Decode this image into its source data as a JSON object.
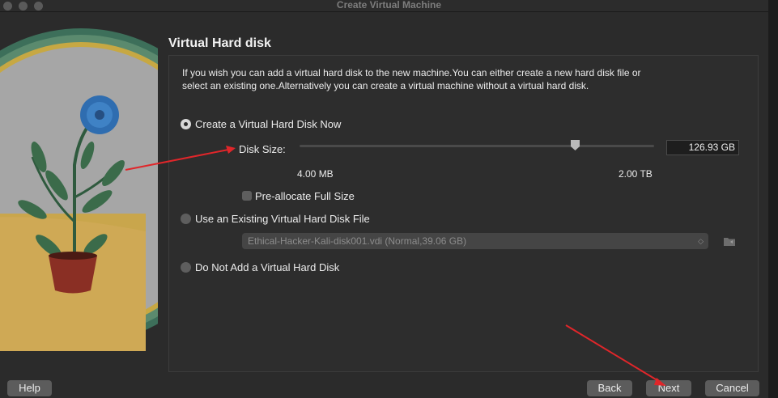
{
  "window": {
    "title": "Create Virtual Machine"
  },
  "heading": "Virtual Hard disk",
  "description": "If you wish you can add a virtual hard disk to the new machine.You can either create a new hard disk file or select an existing one.Alternatively you can create a virtual machine without a virtual hard disk.",
  "options": {
    "create_now": {
      "label": "Create a Virtual Hard Disk Now",
      "selected": true
    },
    "use_existing": {
      "label": "Use an Existing Virtual Hard Disk File",
      "selected": false
    },
    "no_disk": {
      "label": "Do Not Add a Virtual Hard Disk",
      "selected": false
    }
  },
  "disk_size": {
    "label": "Disk Size:",
    "value": "126.93 GB",
    "min_label": "4.00 MB",
    "max_label": "2.00 TB",
    "slider_fraction": 0.78
  },
  "preallocate": {
    "label": "Pre-allocate Full Size",
    "checked": false
  },
  "existing_file": {
    "selected": "Ethical-Hacker-Kali-disk001.vdi (Normal,39.06 GB)"
  },
  "buttons": {
    "help": "Help",
    "back": "Back",
    "next": "Next",
    "cancel": "Cancel"
  },
  "colors": {
    "window_bg": "#2b2b2b",
    "annotation_arrow": "#e0262a"
  }
}
